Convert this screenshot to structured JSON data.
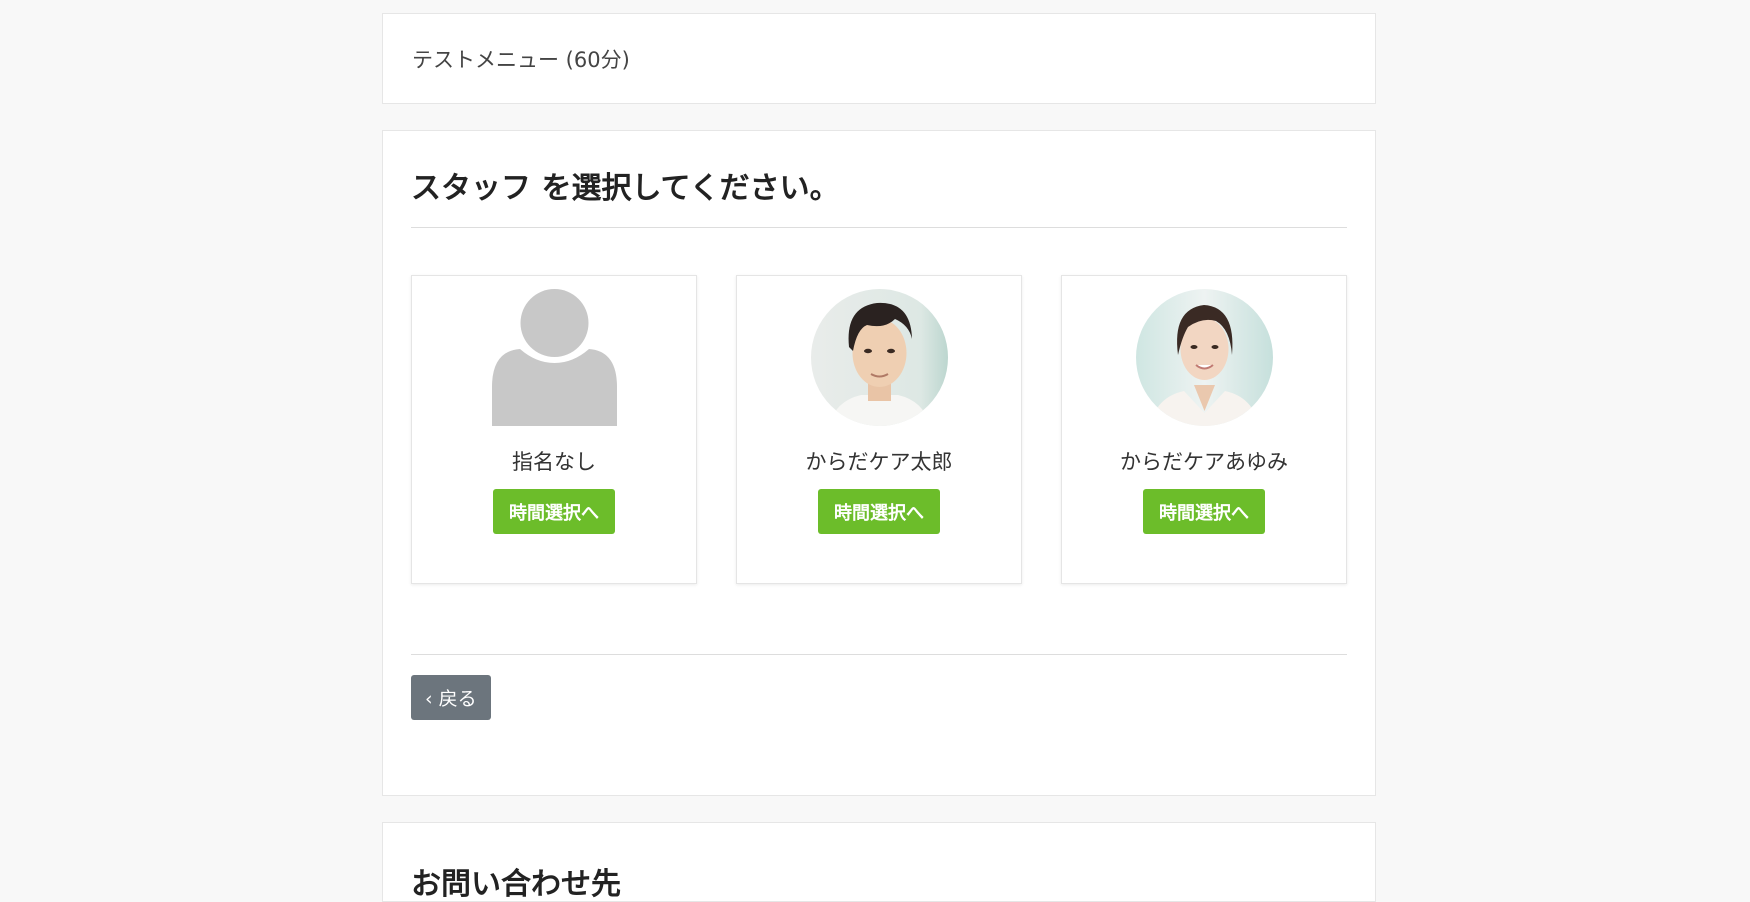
{
  "menu": {
    "name": "テストメニュー (60分)"
  },
  "staff_section": {
    "title": "スタッフ を選択してください。",
    "staff": [
      {
        "name": "指名なし",
        "avatar": "generic-person-icon",
        "button_label": "時間選択へ"
      },
      {
        "name": "からだケア太郎",
        "avatar": "male-staff-photo",
        "button_label": "時間選択へ"
      },
      {
        "name": "からだケアあゆみ",
        "avatar": "female-staff-photo",
        "button_label": "時間選択へ"
      }
    ],
    "back_label": "‹ 戻る"
  },
  "contact": {
    "title": "お問い合わせ先"
  },
  "colors": {
    "primary_button": "#6cbd2a",
    "back_button": "#6c757d",
    "page_background": "#f8f8f8"
  }
}
